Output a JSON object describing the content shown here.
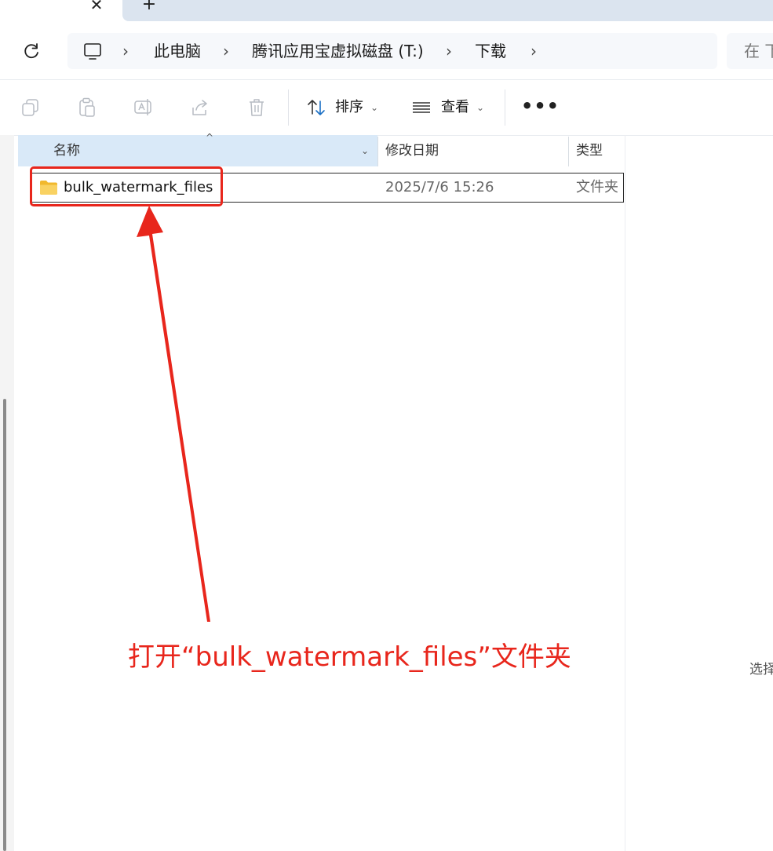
{
  "address_bar": {
    "crumbs": [
      "此电脑",
      "腾讯应用宝虚拟磁盘 (T:)",
      "下载"
    ],
    "search_placeholder": "在 下"
  },
  "toolbar": {
    "sort_label": "排序",
    "view_label": "查看",
    "more_label": "•••"
  },
  "columns": {
    "name": "名称",
    "modified": "修改日期",
    "type": "类型"
  },
  "rows": [
    {
      "name": "bulk_watermark_files",
      "modified": "2025/7/6 15:26",
      "type": "文件夹"
    }
  ],
  "annotation": {
    "text": "打开“bulk_watermark_files”文件夹",
    "color": "#e8261c"
  },
  "status": {
    "text": "选择"
  },
  "colors": {
    "accent": "#d9e9f8",
    "folder": "#f5c342",
    "annotation": "#e8261c"
  }
}
